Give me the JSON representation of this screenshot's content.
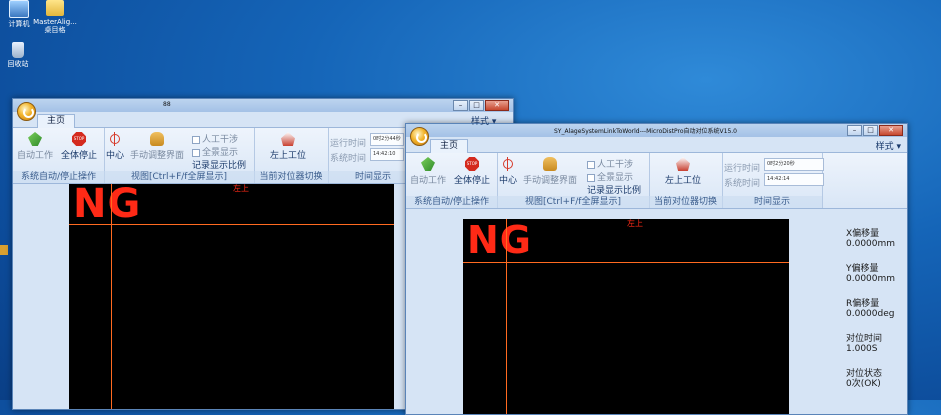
{
  "desktop": {
    "icons": [
      {
        "name": "computer",
        "label": "计算机"
      },
      {
        "name": "masteralign",
        "label": "MasterAlig... 桌目格"
      },
      {
        "name": "recycle-bin",
        "label": "回收站"
      }
    ]
  },
  "window1": {
    "title": "88",
    "tab_main": "主页",
    "style_menu": "样式",
    "ribbon": {
      "auto_work": "自动工作",
      "all_stop": "全体停止",
      "stop_badge": "STOP",
      "group_system": "系统自动/停止操作",
      "center": "中心",
      "manual_adjust": "手动调整界面",
      "manual_interfere": "人工干涉",
      "full_display": "全景显示",
      "record_ratio": "记录显示比例",
      "group_view": "视图[Ctrl+F/f全屏显示]",
      "upper_left_station": "左上工位",
      "group_aligner": "当前对位器切换",
      "run_time_label": "运行时间",
      "run_time_value": "0时2分44秒",
      "system_time_label": "系统时间",
      "system_time_value": "14:42:10",
      "group_time": "时间显示"
    },
    "viewer": {
      "ng_text": "NG",
      "corner_label": "左上"
    }
  },
  "window2": {
    "title": "SY_AlageSystemLinkToWorld---MicroDistPro自动对位系统V15.0",
    "tab_main": "主页",
    "style_menu": "样式",
    "ribbon": {
      "auto_work": "自动工作",
      "all_stop": "全体停止",
      "stop_badge": "STOP",
      "group_system": "系统自动/停止操作",
      "center": "中心",
      "manual_adjust": "手动调整界面",
      "manual_interfere": "人工干涉",
      "full_display": "全景显示",
      "record_ratio": "记录显示比例",
      "group_view": "视图[Ctrl+F/f全屏显示]",
      "upper_left_station": "左上工位",
      "group_aligner": "当前对位器切换",
      "run_time_label": "运行时间",
      "run_time_value": "0时2分20秒",
      "system_time_label": "系统时间",
      "system_time_value": "14:42:14",
      "group_time": "时间显示"
    },
    "viewer": {
      "ng_text": "NG",
      "corner_label": "左上"
    },
    "info": {
      "x_offset_label": "X偏移量",
      "x_offset_value": "0.0000mm",
      "y_offset_label": "Y偏移量",
      "y_offset_value": "0.0000mm",
      "r_offset_label": "R偏移量",
      "r_offset_value": "0.0000deg",
      "align_time_label": "对位时间",
      "align_time_value": "1.000S",
      "align_state_label": "对位状态",
      "align_state_value": "0次(OK)"
    }
  },
  "colors": {
    "desktop": "#1565b8",
    "ng_red": "#ff2a16",
    "crosshair": "#ff6a20",
    "ribbon": "#d6e4f5"
  }
}
